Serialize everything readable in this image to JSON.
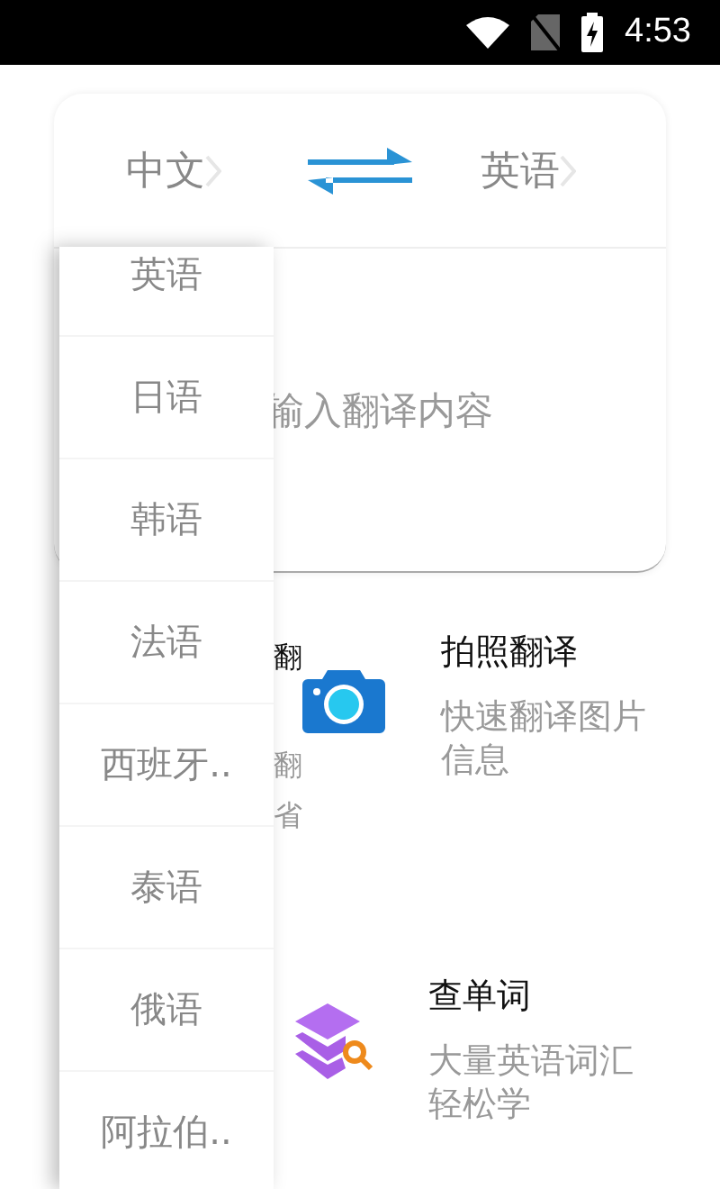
{
  "status_bar": {
    "time": "4:53"
  },
  "language_bar": {
    "source": "中文",
    "target": "英语"
  },
  "input": {
    "placeholder": "输入翻译内容"
  },
  "features": [
    {
      "kind": "hidden",
      "title": "翻",
      "description": [
        "翻",
        "省"
      ]
    },
    {
      "kind": "camera",
      "title": "拍照翻译",
      "description": [
        "快速翻译图片",
        "信息"
      ]
    },
    {
      "kind": "words",
      "title": "查单词",
      "description": [
        "大量英语词汇",
        "轻松学"
      ]
    }
  ],
  "dropdown": {
    "items": [
      "英语",
      "日语",
      "韩语",
      "法语",
      "西班牙..",
      "泰语",
      "俄语",
      "阿拉伯.."
    ]
  }
}
